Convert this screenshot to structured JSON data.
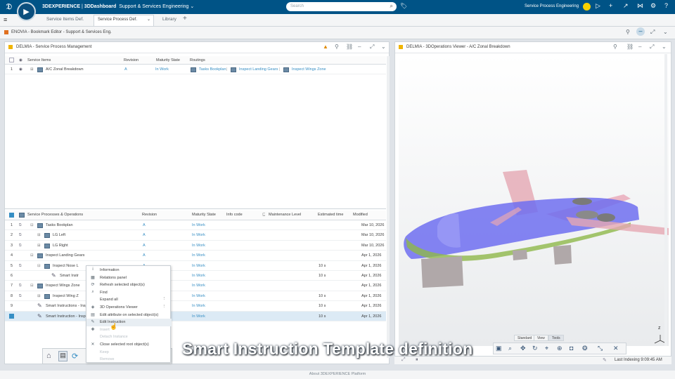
{
  "app": {
    "platform": "3DEXPERIENCE",
    "dashboard": "3DDashboard",
    "context": "Support & Services Engineering",
    "search_placeholder": "Search",
    "user": "Service Process Engineering"
  },
  "tabs": [
    "Service Items Def.",
    "Service Process Def.",
    "Library"
  ],
  "workspace_title": "ENOVIA - Bookmark Editor - Support & Services Eng.",
  "left_panel": {
    "title": "DELMIA - Service Process Management",
    "top_grid": {
      "headers": [
        "Service Items",
        "Revision",
        "Maturity State",
        "Routings"
      ],
      "rows": [
        {
          "num": "1",
          "name": "A/C Zonal Breakdown",
          "rev": "A",
          "state": "In Work",
          "routings": [
            "Tasks Bookplan",
            "Inspect Landing Gears",
            "Inspect Wings Zone"
          ]
        }
      ]
    },
    "bottom_grid": {
      "headers": [
        "Service Processes & Operations",
        "Revision",
        "Maturity State",
        "Info code",
        "Maintenance Level",
        "Estimated time",
        "Modified"
      ],
      "rows": [
        {
          "num": "1",
          "name": "Tasks Bookplan",
          "rev": "A",
          "state": "In Work",
          "time": "",
          "mod": "Mar 10, 2026"
        },
        {
          "num": "2",
          "name": "LG Left",
          "rev": "A",
          "state": "In Work",
          "time": "",
          "mod": "Mar 10, 2026"
        },
        {
          "num": "3",
          "name": "LG Right",
          "rev": "A",
          "state": "In Work",
          "time": "",
          "mod": "Mar 10, 2026"
        },
        {
          "num": "4",
          "name": "Inspect Landing Gears",
          "rev": "A",
          "state": "In Work",
          "time": "",
          "mod": "Apr 1, 2026"
        },
        {
          "num": "5",
          "name": "Inspect Nose L",
          "rev": "A",
          "state": "In Work",
          "time": "10 s",
          "mod": "Apr 1, 2026"
        },
        {
          "num": "6",
          "name": "Smart Instr",
          "rev": "",
          "state": "In Work",
          "time": "10 s",
          "mod": "Apr 1, 2026"
        },
        {
          "num": "7",
          "name": "Inspect Wings Zone",
          "rev": "",
          "state": "In Work",
          "time": "",
          "mod": "Apr 1, 2026"
        },
        {
          "num": "8",
          "name": "Inspect Wing Z",
          "rev": "",
          "state": "In Work",
          "time": "10 s",
          "mod": "Apr 1, 2026"
        },
        {
          "num": "9",
          "name": "Smart Instructions - Insp",
          "rev": "",
          "state": "In Work",
          "time": "10 s",
          "mod": "Apr 1, 2026"
        },
        {
          "num": "",
          "name": "Smart Instruction - Insp",
          "rev": "",
          "state": "In Work",
          "time": "10 s",
          "mod": "Apr 1, 2026"
        }
      ]
    }
  },
  "context_menu": [
    {
      "label": "Information",
      "icon": "i",
      "enabled": true
    },
    {
      "label": "Relations panel",
      "icon": "▦",
      "enabled": true
    },
    {
      "label": "Refresh selected object(s)",
      "icon": "⟳",
      "enabled": true
    },
    {
      "label": "Find",
      "icon": "⌕",
      "enabled": true
    },
    {
      "label": "Expand all",
      "icon": "",
      "enabled": true,
      "submenu": true
    },
    {
      "label": "3D Operations Viewer",
      "icon": "◈",
      "enabled": true,
      "submenu": true
    },
    {
      "label": "Edit attribute on selected object(s)",
      "icon": "▤",
      "enabled": true
    },
    {
      "label": "Edit Instruction",
      "icon": "✎",
      "enabled": true,
      "highlight": true
    },
    {
      "label": "Insert",
      "icon": "✚",
      "enabled": false
    },
    {
      "label": "Detach Instance",
      "icon": "",
      "enabled": false
    },
    {
      "label": "Close selected root object(s)",
      "icon": "✕",
      "enabled": true
    },
    {
      "label": "Keep",
      "icon": "",
      "enabled": false
    },
    {
      "label": "Remove",
      "icon": "",
      "enabled": false
    }
  ],
  "right_panel": {
    "title": "DELMIA - 3DOperations Viewer - A/C Zonal Breakdown",
    "action_tabs": [
      "Standard",
      "View",
      "Tools"
    ],
    "status": "Last Indexing 9:09:45 AM"
  },
  "caption": "Smart Instruction Template definition",
  "footer": "About 3DEXPERIENCE Platform",
  "colors": {
    "topbar": "#005386",
    "link": "#368ec4",
    "fuselage": "#6f6ff0"
  }
}
